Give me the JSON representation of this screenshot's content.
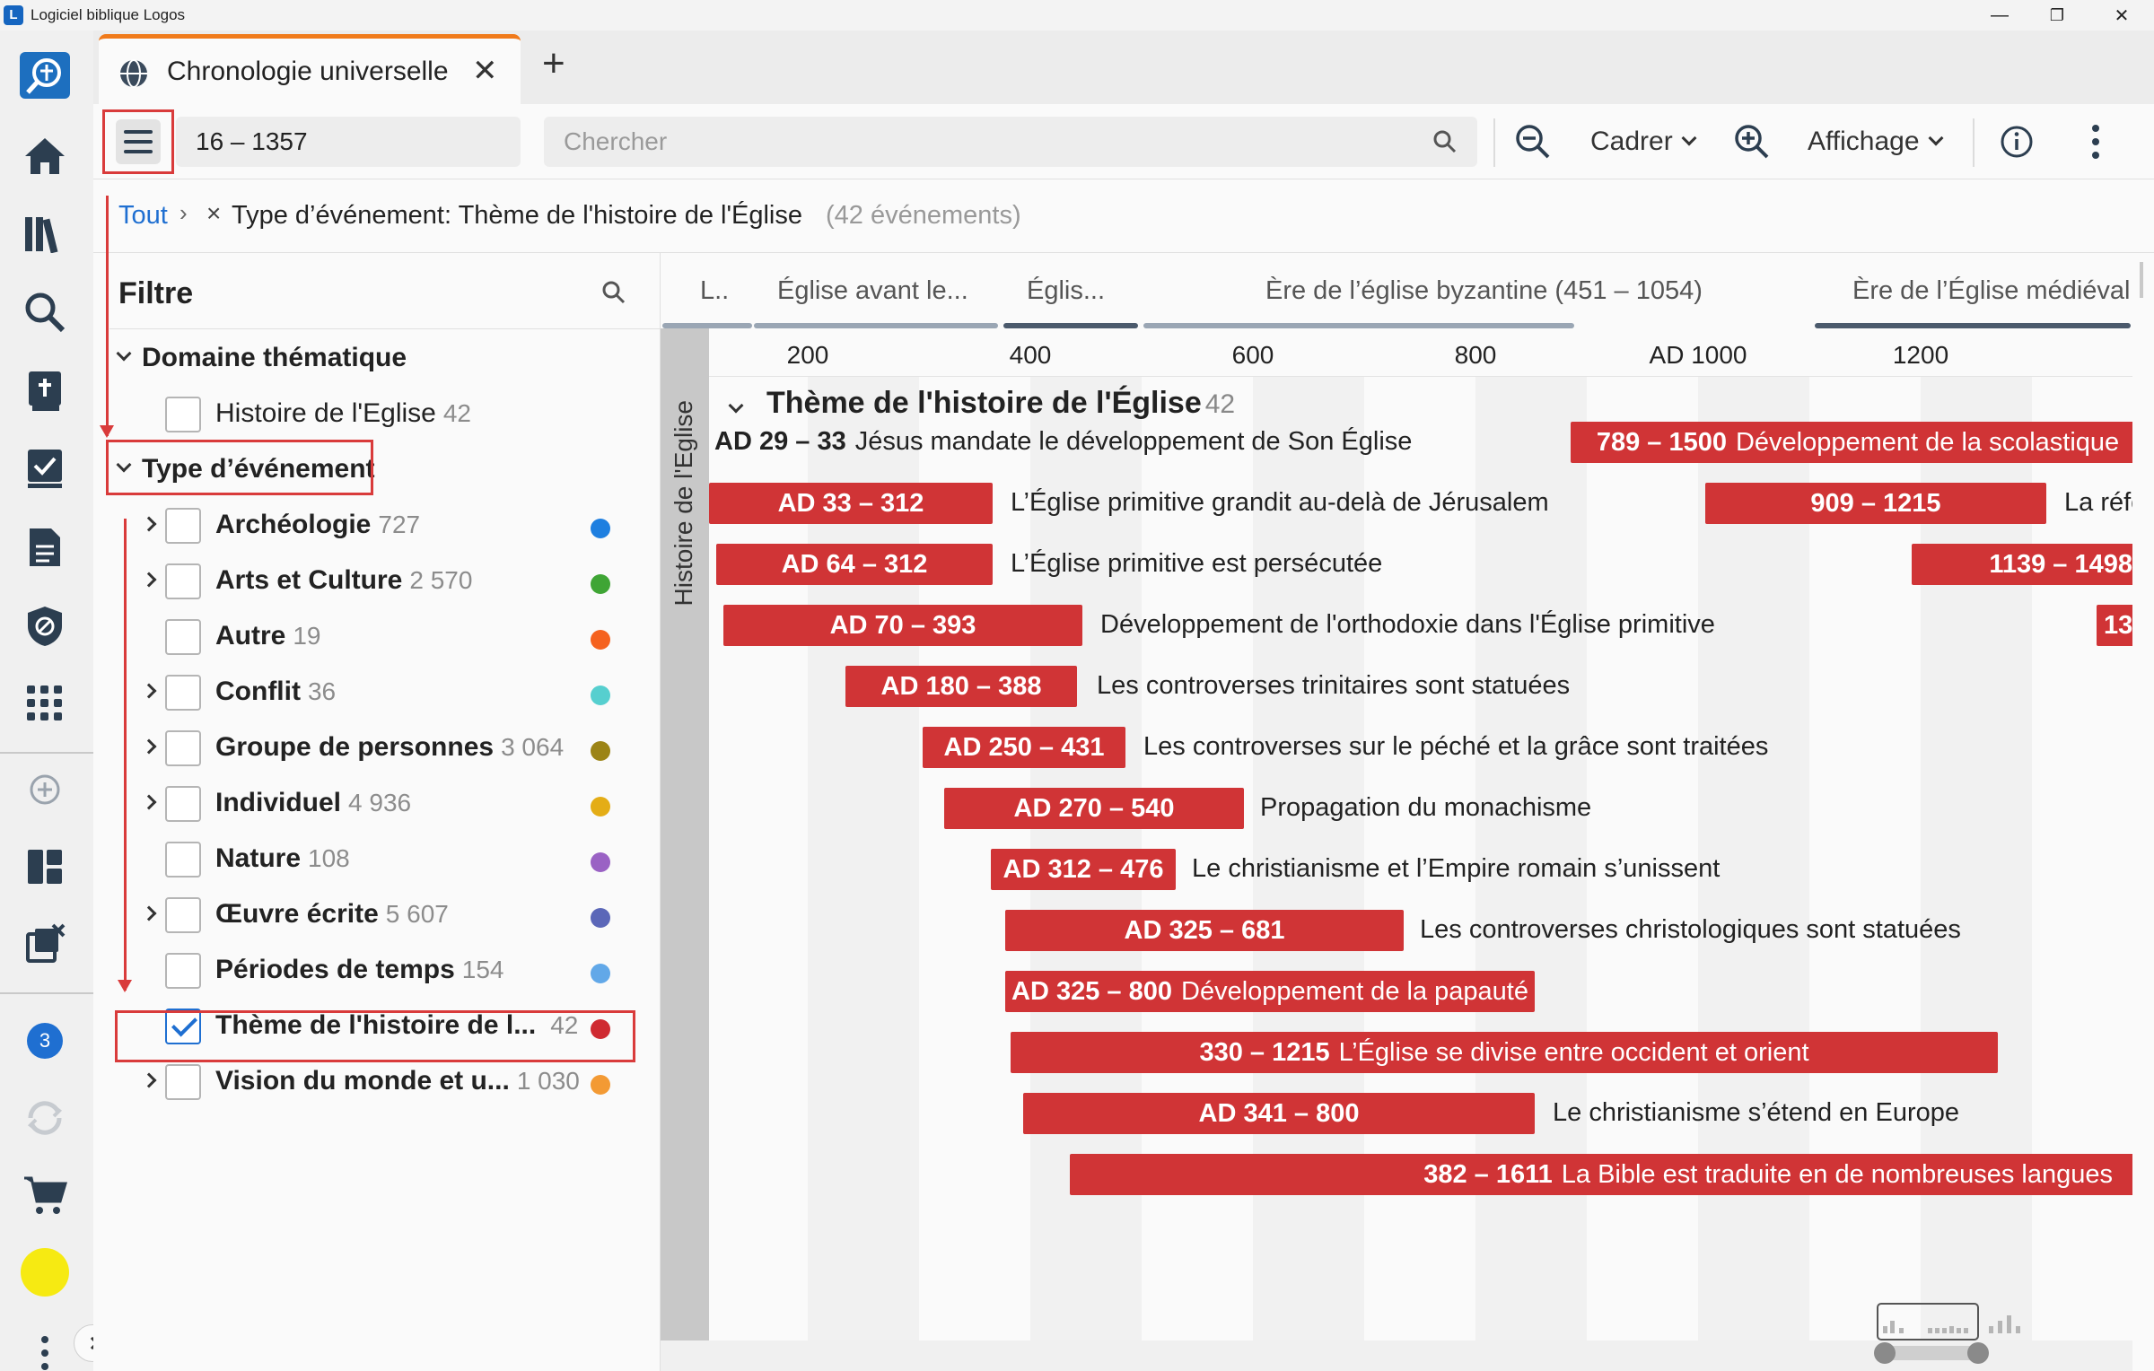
{
  "window": {
    "title": "Logiciel biblique Logos",
    "minimize": "—",
    "maximize": "❐",
    "close": "✕"
  },
  "rail": {
    "notification_count": "3"
  },
  "tab": {
    "title": "Chronologie universelle",
    "close": "✕",
    "add": "+"
  },
  "toolbar": {
    "range": "16 – 1357",
    "search_placeholder": "Chercher",
    "frame_label": "Cadrer",
    "display_label": "Affichage"
  },
  "breadcrumb": {
    "all": "Tout",
    "separator": "›",
    "remove": "×",
    "filter_label": "Type d’événement: Thème de l'histoire de l'Église",
    "filter_count": "(42 événements)"
  },
  "filter": {
    "title": "Filtre",
    "sections": [
      {
        "label": "Domaine thématique",
        "items": [
          {
            "label": "Histoire de l'Eglise",
            "count": "42",
            "checked": false,
            "expandable": false
          }
        ]
      },
      {
        "label": "Type d’événement",
        "items": [
          {
            "label": "Archéologie",
            "count": "727",
            "checked": false,
            "expandable": true,
            "color": "#1e7fe0"
          },
          {
            "label": "Arts et Culture",
            "count": "2 570",
            "checked": false,
            "expandable": true,
            "color": "#3fa535"
          },
          {
            "label": "Autre",
            "count": "19",
            "checked": false,
            "expandable": false,
            "color": "#f5621f"
          },
          {
            "label": "Conflit",
            "count": "36",
            "checked": false,
            "expandable": true,
            "color": "#56cfcf"
          },
          {
            "label": "Groupe de personnes",
            "count": "3 064",
            "checked": false,
            "expandable": true,
            "color": "#9c8416"
          },
          {
            "label": "Individuel",
            "count": "4 936",
            "checked": false,
            "expandable": true,
            "color": "#e4ad16"
          },
          {
            "label": "Nature",
            "count": "108",
            "checked": false,
            "expandable": false,
            "color": "#9a62c4"
          },
          {
            "label": "Œuvre écrite",
            "count": "5 607",
            "checked": false,
            "expandable": true,
            "color": "#5b67b8"
          },
          {
            "label": "Périodes de temps",
            "count": "154",
            "checked": false,
            "expandable": false,
            "color": "#62a8e8"
          },
          {
            "label": "Thème de l'histoire de l...",
            "count": "42",
            "checked": true,
            "expandable": false,
            "color": "#cf2a31"
          },
          {
            "label": "Vision du monde et u...",
            "count": "1 030",
            "checked": false,
            "expandable": true,
            "color": "#f39a34"
          }
        ]
      }
    ]
  },
  "timeline": {
    "eras": [
      "L..",
      "Église avant le...",
      "Églis...",
      "Ère de l’église byzantine (451 – 1054)",
      "Ère de l’Église médiéval"
    ],
    "ticks": [
      "200",
      "400",
      "600",
      "800",
      "AD 1000",
      "1200"
    ],
    "band_label": "Histoire de l'Eglise",
    "group_title": "Thème de l'histoire de l'Église",
    "group_count": "42",
    "events": [
      {
        "dates": "AD 29 – 33",
        "label": "Jésus mandate le développement de Son Église"
      },
      {
        "dates": "789 – 1500",
        "label": "Développement de la scolastique"
      },
      {
        "dates": "AD 33 – 312",
        "label": "L’Église primitive grandit au-delà de Jérusalem"
      },
      {
        "dates": "909 – 1215",
        "label": "La réforme"
      },
      {
        "dates": "AD 64 – 312",
        "label": "L’Église primitive est persécutée"
      },
      {
        "dates": "1139 – 1498",
        "label": ""
      },
      {
        "dates": "AD 70 – 393",
        "label": "Développement de l'orthodoxie dans l'Église primitive"
      },
      {
        "dates": "13",
        "label": ""
      },
      {
        "dates": "AD 180 – 388",
        "label": "Les controverses trinitaires sont statuées"
      },
      {
        "dates": "AD 250 – 431",
        "label": "Les controverses sur le péché et la grâce sont traitées"
      },
      {
        "dates": "AD 270 – 540",
        "label": "Propagation du monachisme"
      },
      {
        "dates": "AD 312 – 476",
        "label": "Le christianisme et l’Empire romain s’unissent"
      },
      {
        "dates": "AD 325 – 681",
        "label": "Les controverses christologiques sont statuées"
      },
      {
        "dates": "AD 325 – 800",
        "label": "Développement de la papauté"
      },
      {
        "dates": "330 – 1215",
        "label": "L’Église se divise entre occident et orient"
      },
      {
        "dates": "AD 341 – 800",
        "label": "Le christianisme s’étend en Europe"
      },
      {
        "dates": "382 – 1611",
        "label": "La Bible est traduite en de nombreuses langues"
      }
    ]
  },
  "colors": {
    "accent": "#f07a1a",
    "event_bar": "#d03436",
    "link": "#1f6fd1",
    "annotation": "#d93b3b"
  }
}
